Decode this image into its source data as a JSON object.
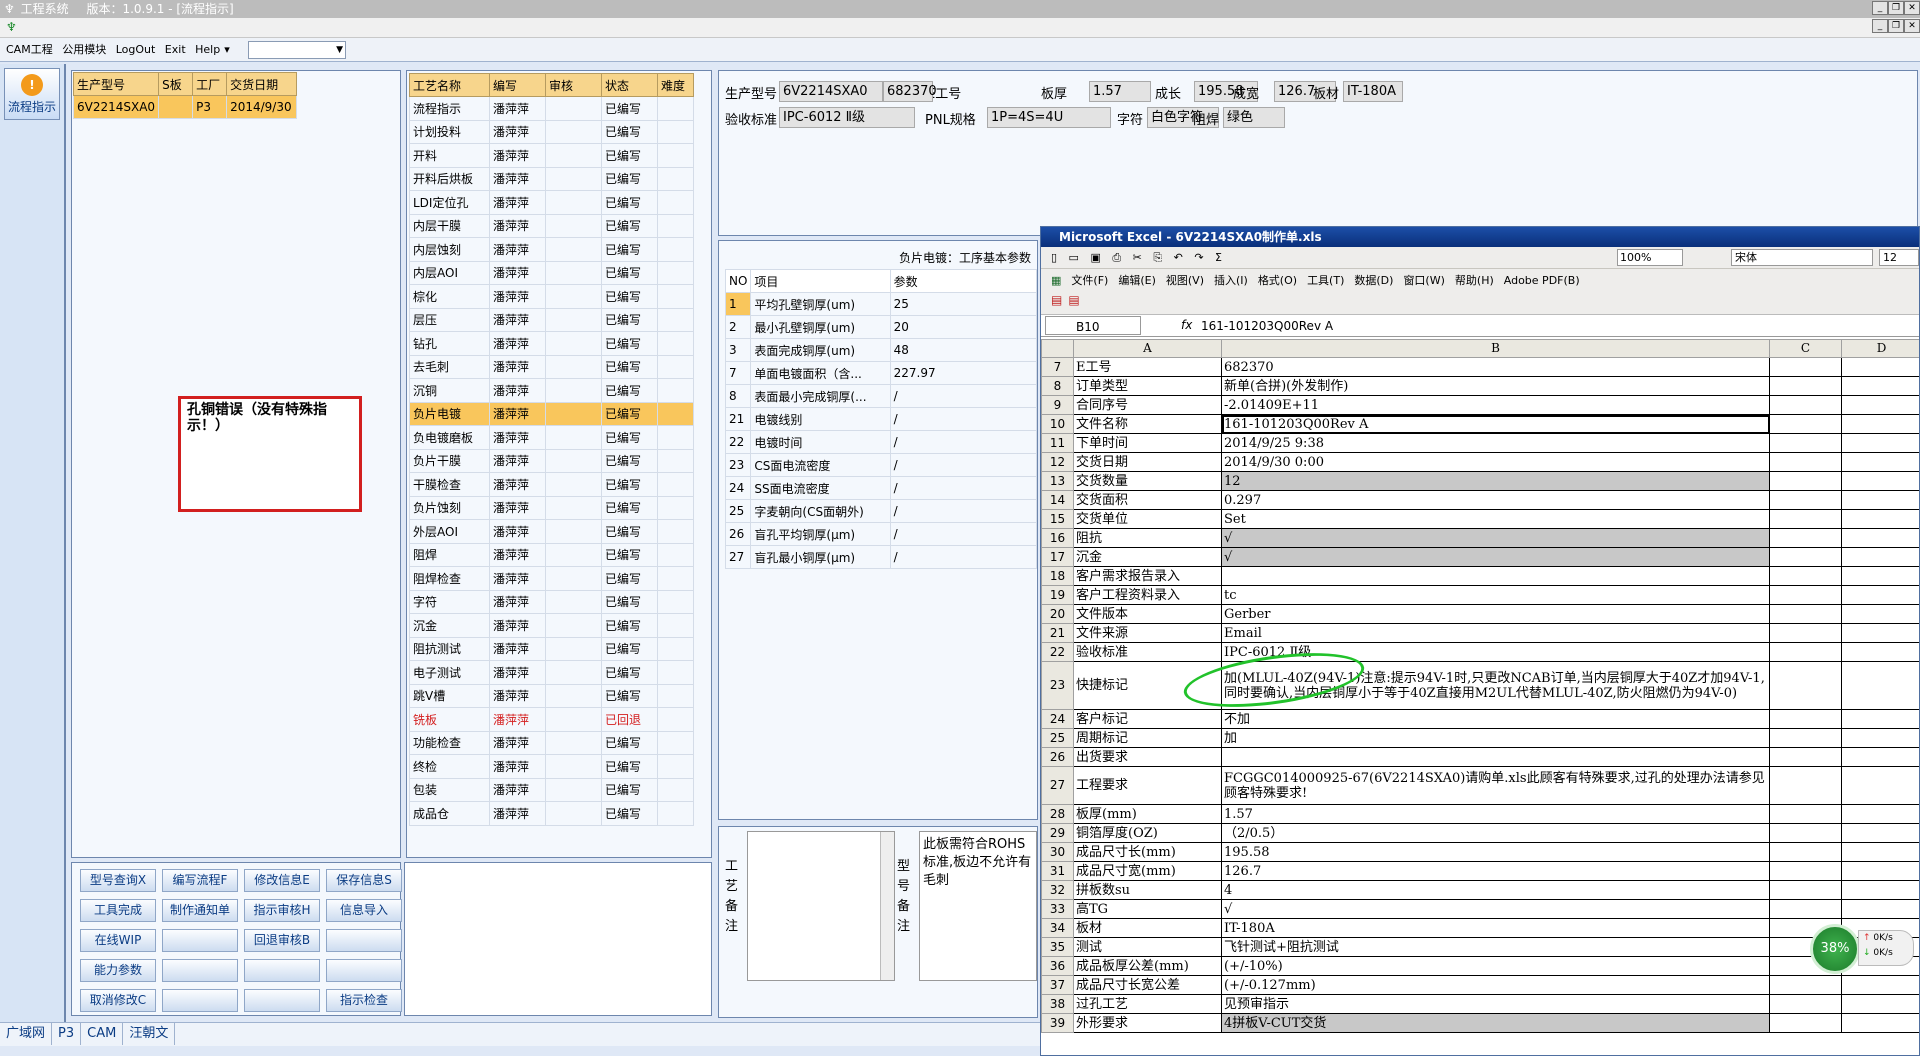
{
  "window": {
    "title": "工程系统",
    "version": "版本：1.0.9.1 - [流程指示]"
  },
  "menu": {
    "items": [
      "CAM工程",
      "公用模块",
      "LogOut",
      "Exit",
      "Help"
    ]
  },
  "nav": {
    "flow_btn": "流程指示"
  },
  "orders": {
    "headers": [
      "生产型号",
      "S板",
      "工厂",
      "交货日期"
    ],
    "rows": [
      [
        "6V2214SXA0",
        "",
        "P3",
        "2014/9/30"
      ]
    ]
  },
  "note": "孔铜错误（没有特殊指示！）",
  "process": {
    "headers": [
      "工艺名称",
      "编写",
      "审核",
      "状态",
      "难度"
    ],
    "rows": [
      [
        "流程指示",
        "潘萍萍",
        "",
        "已编写",
        ""
      ],
      [
        "计划投料",
        "潘萍萍",
        "",
        "已编写",
        ""
      ],
      [
        "开料",
        "潘萍萍",
        "",
        "已编写",
        ""
      ],
      [
        "开料后烘板",
        "潘萍萍",
        "",
        "已编写",
        ""
      ],
      [
        "LDI定位孔",
        "潘萍萍",
        "",
        "已编写",
        ""
      ],
      [
        "内层干膜",
        "潘萍萍",
        "",
        "已编写",
        ""
      ],
      [
        "内层蚀刻",
        "潘萍萍",
        "",
        "已编写",
        ""
      ],
      [
        "内层AOI",
        "潘萍萍",
        "",
        "已编写",
        ""
      ],
      [
        "棕化",
        "潘萍萍",
        "",
        "已编写",
        ""
      ],
      [
        "层压",
        "潘萍萍",
        "",
        "已编写",
        ""
      ],
      [
        "钻孔",
        "潘萍萍",
        "",
        "已编写",
        ""
      ],
      [
        "去毛刺",
        "潘萍萍",
        "",
        "已编写",
        ""
      ],
      [
        "沉铜",
        "潘萍萍",
        "",
        "已编写",
        ""
      ],
      [
        "负片电镀",
        "潘萍萍",
        "",
        "已编写",
        ""
      ],
      [
        "负电镀磨板",
        "潘萍萍",
        "",
        "已编写",
        ""
      ],
      [
        "负片干膜",
        "潘萍萍",
        "",
        "已编写",
        ""
      ],
      [
        "干膜检查",
        "潘萍萍",
        "",
        "已编写",
        ""
      ],
      [
        "负片蚀刻",
        "潘萍萍",
        "",
        "已编写",
        ""
      ],
      [
        "外层AOI",
        "潘萍萍",
        "",
        "已编写",
        ""
      ],
      [
        "阻焊",
        "潘萍萍",
        "",
        "已编写",
        ""
      ],
      [
        "阻焊检查",
        "潘萍萍",
        "",
        "已编写",
        ""
      ],
      [
        "字符",
        "潘萍萍",
        "",
        "已编写",
        ""
      ],
      [
        "沉金",
        "潘萍萍",
        "",
        "已编写",
        ""
      ],
      [
        "阻抗测试",
        "潘萍萍",
        "",
        "已编写",
        ""
      ],
      [
        "电子测试",
        "潘萍萍",
        "",
        "已编写",
        ""
      ],
      [
        "跳V槽",
        "潘萍萍",
        "",
        "已编写",
        ""
      ],
      [
        "铣板",
        "潘萍萍",
        "",
        "已回退",
        ""
      ],
      [
        "功能检查",
        "潘萍萍",
        "",
        "已编写",
        ""
      ],
      [
        "终检",
        "潘萍萍",
        "",
        "已编写",
        ""
      ],
      [
        "包装",
        "潘萍萍",
        "",
        "已编写",
        ""
      ],
      [
        "成品仓",
        "潘萍萍",
        "",
        "已编写",
        ""
      ]
    ],
    "selected_index": 13,
    "returned_index": 26
  },
  "buttons": [
    "型号查询X",
    "编写流程F",
    "修改信息E",
    "保存信息S",
    "工具完成",
    "制作通知单",
    "指示审核H",
    "信息导入",
    "在线WIP",
    "",
    "回退审核B",
    "",
    "能力参数",
    "",
    "",
    "",
    "取消修改C",
    "",
    "",
    "指示检查"
  ],
  "info": {
    "fields": [
      {
        "label": "生产型号",
        "value": "6V2214SXA0"
      },
      {
        "label": "E工号",
        "value": "682370"
      },
      {
        "label": "板厚",
        "value": "1.57"
      },
      {
        "label": "成长",
        "value": "195.58"
      },
      {
        "label": "成宽",
        "value": "126.7"
      },
      {
        "label": "板材",
        "value": "IT-180A"
      },
      {
        "label": "验收标准",
        "value": "IPC-6012 Ⅱ级"
      },
      {
        "label": "PNL规格",
        "value": "1P=4S=4U"
      },
      {
        "label": "字符",
        "value": "白色字符"
      },
      {
        "label": "阻焊",
        "value": "绿色"
      }
    ]
  },
  "params": {
    "caption": "负片电镀：工序基本参数",
    "headers": [
      "NO",
      "项目",
      "参数"
    ],
    "rows": [
      [
        "1",
        "平均孔壁铜厚(um)",
        "25"
      ],
      [
        "2",
        "最小孔壁铜厚(um)",
        "20"
      ],
      [
        "3",
        "表面完成铜厚(um)",
        "48"
      ],
      [
        "7",
        "单面电镀面积（含...",
        "227.97"
      ],
      [
        "8",
        "表面最小完成铜厚(...",
        "/"
      ],
      [
        "21",
        "电镀线别",
        "/"
      ],
      [
        "22",
        "电镀时间",
        "/"
      ],
      [
        "23",
        "CS面电流密度",
        "/"
      ],
      [
        "24",
        "SS面电流密度",
        "/"
      ],
      [
        "25",
        "字麦朝向(CS面朝外)",
        "/"
      ],
      [
        "26",
        "盲孔平均铜厚(μm)",
        "/"
      ],
      [
        "27",
        "盲孔最小铜厚(μm)",
        "/"
      ]
    ]
  },
  "bottom": {
    "memo_label": "工艺备注",
    "model_label": "型号备注",
    "model_text": "此板需符合ROHS标准,板边不允许有毛刺"
  },
  "status": {
    "items": [
      "广域网",
      "P3",
      "CAM",
      "汪朝文"
    ]
  },
  "excel": {
    "title": "Microsoft Excel - 6V2214SXA0制作单.xls",
    "zoom": "100%",
    "font": "宋体",
    "size": "12",
    "menu": [
      "文件(F)",
      "编辑(E)",
      "视图(V)",
      "插入(I)",
      "格式(O)",
      "工具(T)",
      "数据(D)",
      "窗口(W)",
      "帮助(H)",
      "Adobe PDF(B)"
    ],
    "cell_ref": "B10",
    "formula": "161-101203Q00Rev A",
    "cols": [
      "A",
      "B",
      "C",
      "D"
    ],
    "rows": [
      [
        "7",
        "E工号",
        "682370",
        false
      ],
      [
        "8",
        "订单类型",
        "新单(合拼)(外发制作)",
        false
      ],
      [
        "9",
        "合同序号",
        "-2.01409E+11",
        false
      ],
      [
        "10",
        "文件名称",
        "161-101203Q00Rev A",
        false
      ],
      [
        "11",
        "下单时间",
        "2014/9/25 9:38",
        false
      ],
      [
        "12",
        "交货日期",
        "2014/9/30 0:00",
        false
      ],
      [
        "13",
        "交货数量",
        "12",
        true
      ],
      [
        "14",
        "交货面积",
        "0.297",
        false
      ],
      [
        "15",
        "交货单位",
        "Set",
        false
      ],
      [
        "16",
        "阻抗",
        "√",
        true
      ],
      [
        "17",
        "沉金",
        "√",
        true
      ],
      [
        "18",
        "客户需求报告录入",
        "",
        false
      ],
      [
        "19",
        "客户工程资料录入",
        "tc",
        false
      ],
      [
        "20",
        "文件版本",
        "Gerber",
        false
      ],
      [
        "21",
        "文件来源",
        "Email",
        false
      ],
      [
        "22",
        "验收标准",
        "IPC-6012 Ⅱ级",
        false
      ],
      [
        "23",
        "快捷标记",
        "加(MLUL-40Z(94V-1)注意:提示94V-1时,只更改NCAB订单,当内层铜厚大于40Z才加94V-1,同时要确认,当内层铜厚小于等于40Z直接用M2UL代替MLUL-40Z,防火阻燃仍为94V-0)",
        false
      ],
      [
        "24",
        "客户标记",
        "不加",
        false
      ],
      [
        "25",
        "周期标记",
        "加",
        false
      ],
      [
        "26",
        "出货要求",
        "",
        false
      ],
      [
        "27",
        "工程要求",
        "FCGGC014000925-67(6V2214SXA0)请购单.xls此顾客有特殊要求,过孔的处理办法请参见顾客特殊要求!",
        false
      ],
      [
        "28",
        "板厚(mm)",
        "1.57",
        false
      ],
      [
        "29",
        "铜箔厚度(OZ)",
        "（2/0.5）",
        false
      ],
      [
        "30",
        "成品尺寸长(mm)",
        "195.58",
        false
      ],
      [
        "31",
        "成品尺寸宽(mm)",
        "126.7",
        false
      ],
      [
        "32",
        "拼板数su",
        "4",
        false
      ],
      [
        "33",
        "高TG",
        "√",
        false
      ],
      [
        "34",
        "板材",
        "IT-180A",
        false
      ],
      [
        "35",
        "测试",
        "飞针测试+阻抗测试",
        false
      ],
      [
        "36",
        "成品板厚公差(mm)",
        "(+/-10%)",
        false
      ],
      [
        "37",
        "成品尺寸长宽公差",
        "(+/-0.127mm)",
        false
      ],
      [
        "38",
        "过孔工艺",
        "见预审指示",
        false
      ],
      [
        "39",
        "外形要求",
        "4拼板V-CUT交货",
        true
      ]
    ]
  },
  "gauge": {
    "percent": "38%",
    "up": "0K/s",
    "down": "0K/s"
  }
}
